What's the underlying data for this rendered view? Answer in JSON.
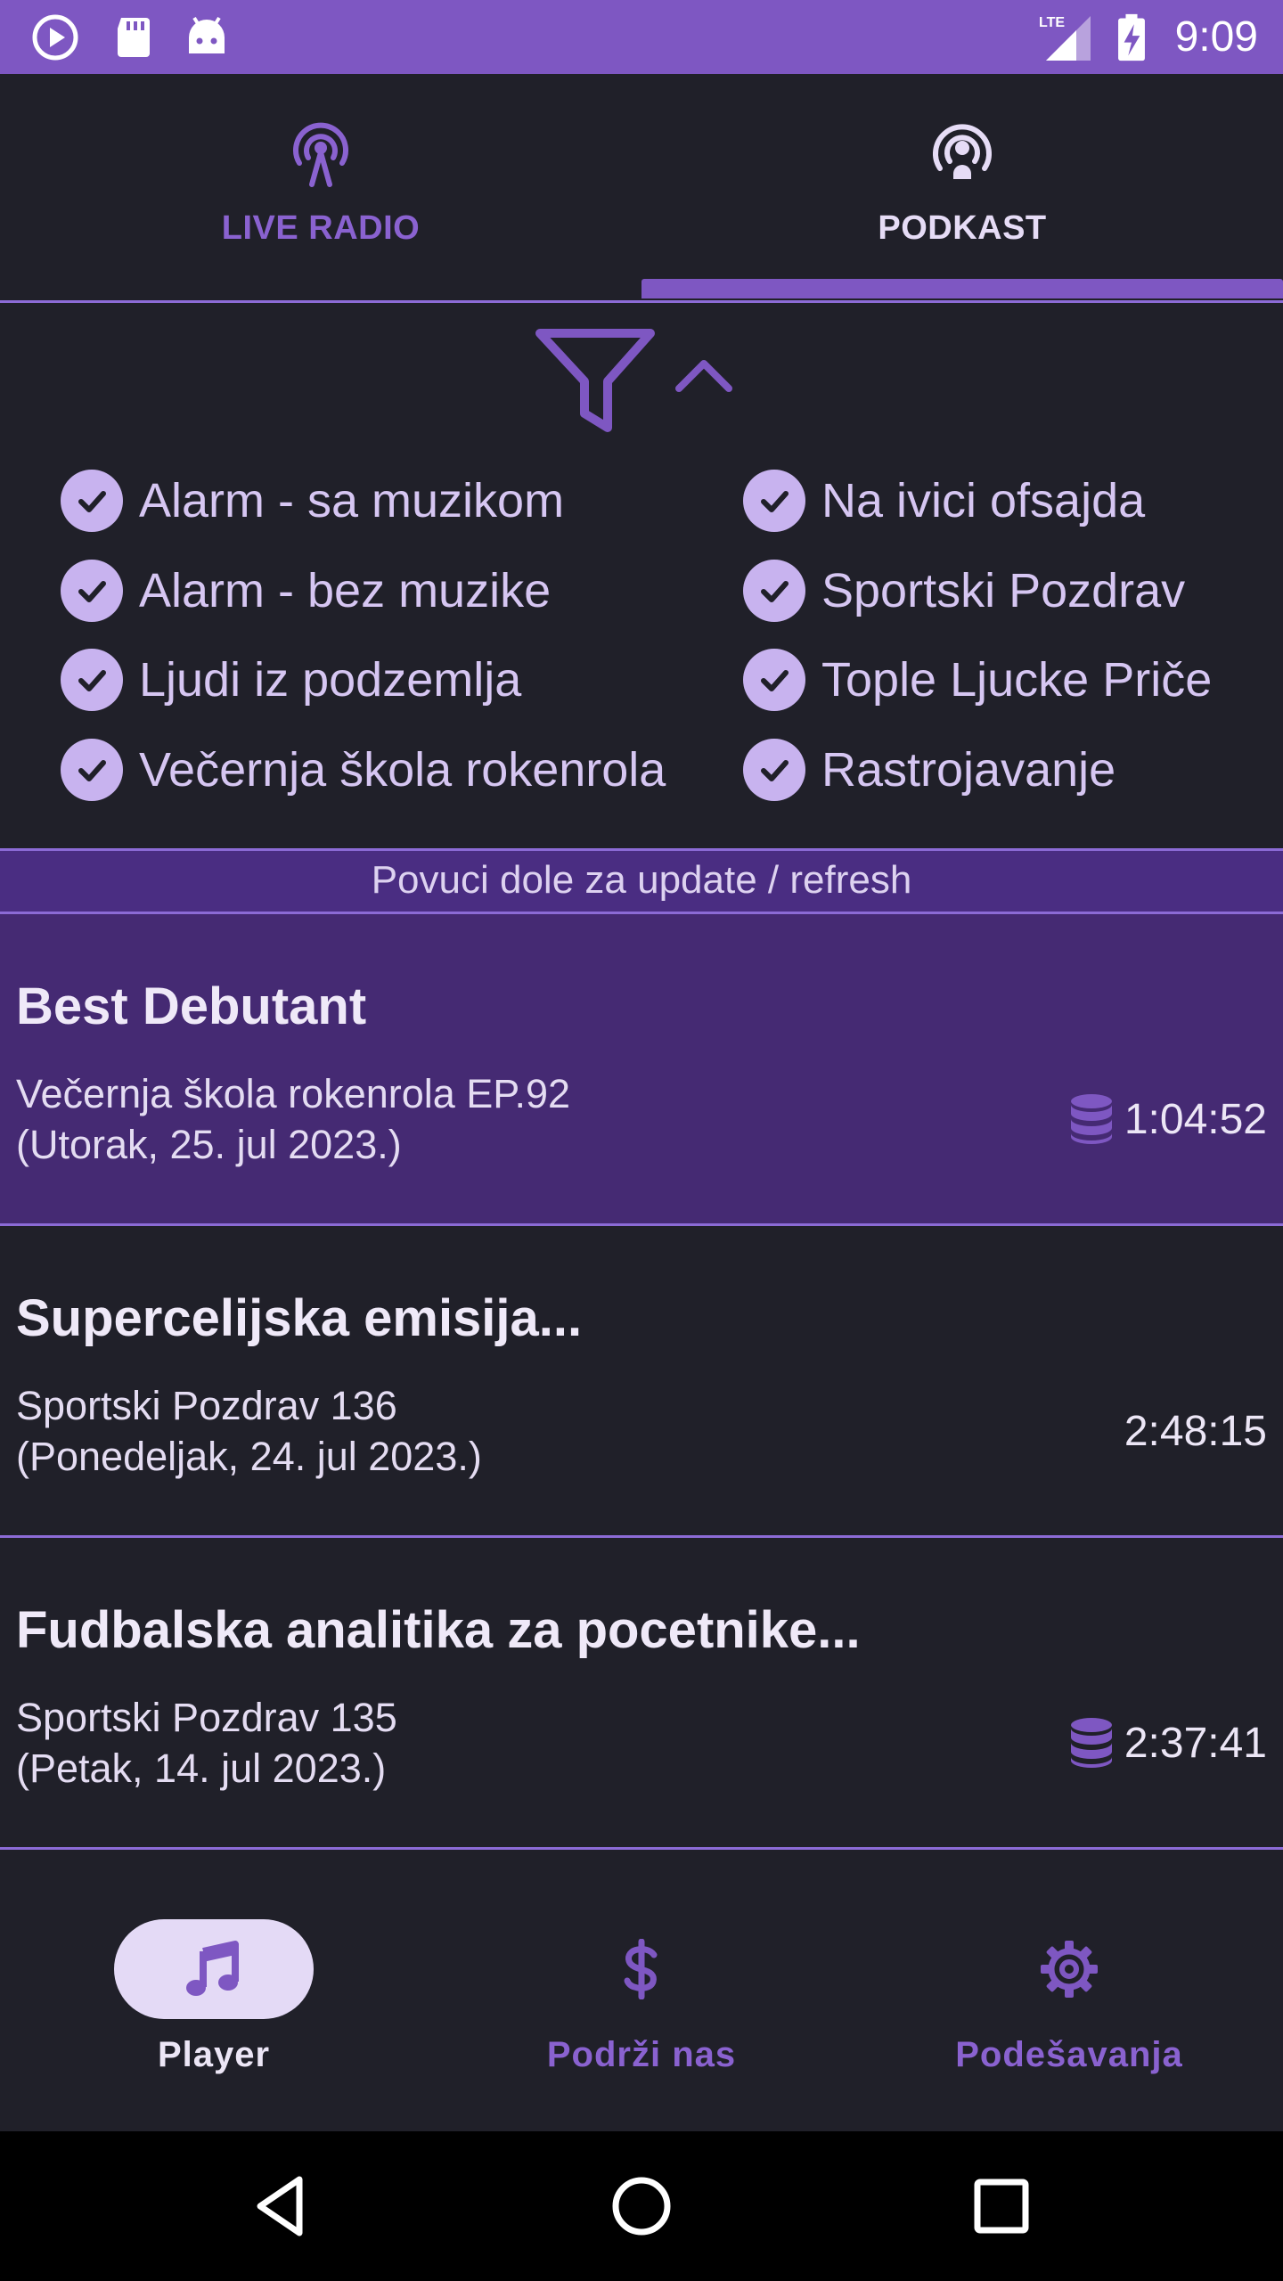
{
  "status_bar": {
    "time": "9:09",
    "network": "LTE",
    "icons": [
      "play-circle-icon",
      "sd-card-icon",
      "android-icon",
      "lte-signal-icon",
      "battery-charging-icon"
    ]
  },
  "tabs": [
    {
      "label": "LIVE RADIO",
      "icon": "broadcast-tower-icon",
      "selected": false
    },
    {
      "label": "PODKAST",
      "icon": "podcast-icon",
      "selected": true
    }
  ],
  "filter": {
    "icon": "filter-funnel-icon",
    "toggle_icon": "chevron-up-icon",
    "shows": [
      {
        "label": "Alarm - sa muzikom",
        "checked": true
      },
      {
        "label": "Na ivici ofsajda",
        "checked": true
      },
      {
        "label": "Alarm - bez muzike",
        "checked": true
      },
      {
        "label": "Sportski Pozdrav",
        "checked": true
      },
      {
        "label": "Ljudi iz podzemlja",
        "checked": true
      },
      {
        "label": "Tople Ljucke Priče",
        "checked": true
      },
      {
        "label": "Večernja škola rokenrola",
        "checked": true
      },
      {
        "label": "Rastrojavanje",
        "checked": true
      }
    ]
  },
  "refresh_hint": "Povuci dole za update / refresh",
  "episodes": [
    {
      "title": "Best Debutant",
      "show": "Večernja škola rokenrola EP.92",
      "date": "(Utorak, 25. jul 2023.)",
      "duration": "1:04:52",
      "downloaded": true,
      "selected": true
    },
    {
      "title": "Supercelijska emisija...",
      "show": "Sportski Pozdrav 136",
      "date": "(Ponedeljak, 24. jul 2023.)",
      "duration": "2:48:15",
      "downloaded": false,
      "selected": false
    },
    {
      "title": "Fudbalska analitika za pocetnike...",
      "show": "Sportski Pozdrav 135",
      "date": "(Petak, 14. jul 2023.)",
      "duration": "2:37:41",
      "downloaded": true,
      "selected": false
    }
  ],
  "bottom_nav": [
    {
      "label": "Player",
      "icon": "music-note-icon",
      "selected": true
    },
    {
      "label": "Podrži nas",
      "icon": "dollar-icon",
      "selected": false
    },
    {
      "label": "Podešavanja",
      "icon": "gear-icon",
      "selected": false
    }
  ],
  "colors": {
    "accent": "#7e57c2",
    "background": "#202029",
    "selected_row": "#452a73",
    "chip_check": "#c8b3ef"
  }
}
